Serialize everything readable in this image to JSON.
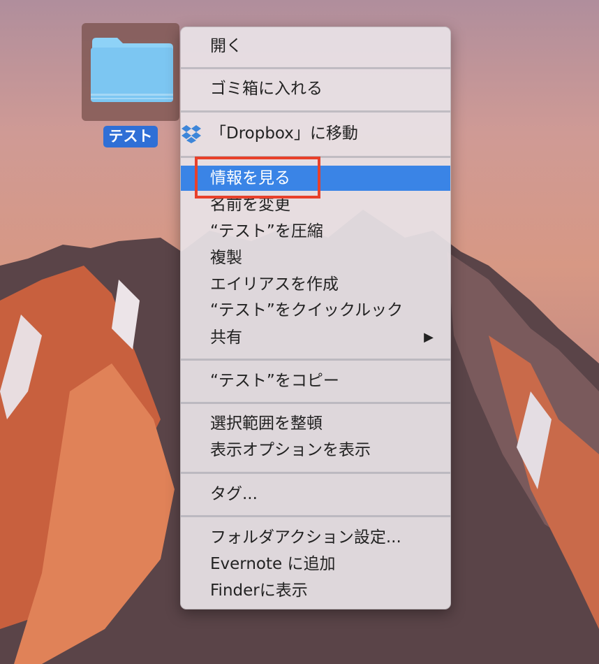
{
  "desktop": {
    "folder_name": "テスト"
  },
  "context_menu": {
    "items": [
      {
        "label": "開く"
      },
      {
        "label": "ゴミ箱に入れる"
      },
      {
        "label": "「Dropbox」に移動",
        "icon": "dropbox-icon"
      },
      {
        "label": "情報を見る",
        "highlighted": true
      },
      {
        "label": "名前を変更"
      },
      {
        "label": "“テスト”を圧縮"
      },
      {
        "label": "複製"
      },
      {
        "label": "エイリアスを作成"
      },
      {
        "label": "“テスト”をクイックルック"
      },
      {
        "label": "共有",
        "submenu_arrow": "▶"
      },
      {
        "label": "“テスト”をコピー"
      },
      {
        "label": "選択範囲を整頓"
      },
      {
        "label": "表示オプションを表示"
      },
      {
        "label": "タグ..."
      },
      {
        "label": "フォルダアクション設定..."
      },
      {
        "label": "Evernote に追加"
      },
      {
        "label": "Finderに表示"
      }
    ]
  },
  "colors": {
    "highlight": "#3a84e6",
    "annotation": "#e8402a",
    "folder": "#7cc6f2"
  }
}
